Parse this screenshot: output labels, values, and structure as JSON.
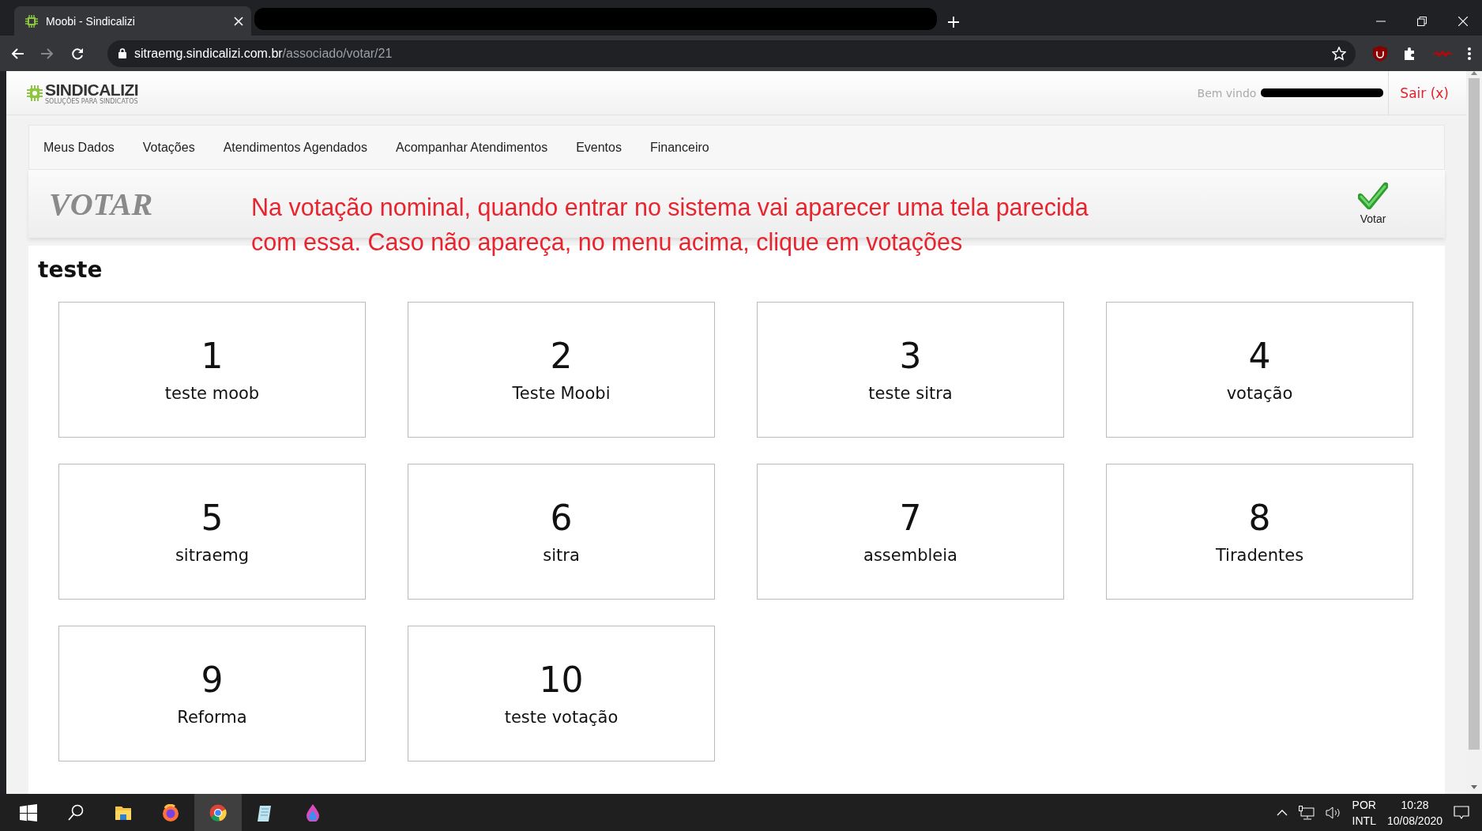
{
  "browser": {
    "tab_title": "Moobi - Sindicalizi",
    "url_host": "sitraemg.sindicalizi.com.br",
    "url_path": "/associado/votar/21"
  },
  "header": {
    "logo": "SINDICALIZI",
    "logo_tagline": "SOLUÇÕES PARA SINDICATOS",
    "welcome": "Bem vindo",
    "logout": "Sair (x)"
  },
  "nav": [
    "Meus Dados",
    "Votações",
    "Atendimentos Agendados",
    "Acompanhar Atendimentos",
    "Eventos",
    "Financeiro"
  ],
  "page_title": "VOTAR",
  "annotation": "Na votação nominal, quando entrar no sistema vai aparecer uma tela parecida com essa. Caso não apareça, no menu acima, clique em votações",
  "action": "Votar",
  "section_title": "teste",
  "cards": [
    {
      "number": "1",
      "label": "teste moob"
    },
    {
      "number": "2",
      "label": "Teste Moobi"
    },
    {
      "number": "3",
      "label": "teste sitra"
    },
    {
      "number": "4",
      "label": "votação"
    },
    {
      "number": "5",
      "label": "sitraemg"
    },
    {
      "number": "6",
      "label": "sitra"
    },
    {
      "number": "7",
      "label": "assembleia"
    },
    {
      "number": "8",
      "label": "Tiradentes"
    },
    {
      "number": "9",
      "label": "Reforma"
    },
    {
      "number": "10",
      "label": "teste votação"
    }
  ],
  "taskbar": {
    "apps": [
      {
        "kind": "start",
        "selected": false
      },
      {
        "kind": "search",
        "selected": false
      },
      {
        "kind": "folder",
        "selected": false
      },
      {
        "kind": "firefox",
        "selected": false
      },
      {
        "kind": "chrome",
        "selected": true
      },
      {
        "kind": "notepad",
        "selected": false
      },
      {
        "kind": "droplet",
        "selected": false
      }
    ],
    "language": "POR",
    "layout": "INTL",
    "time": "10:28",
    "date": "10/08/2020"
  }
}
